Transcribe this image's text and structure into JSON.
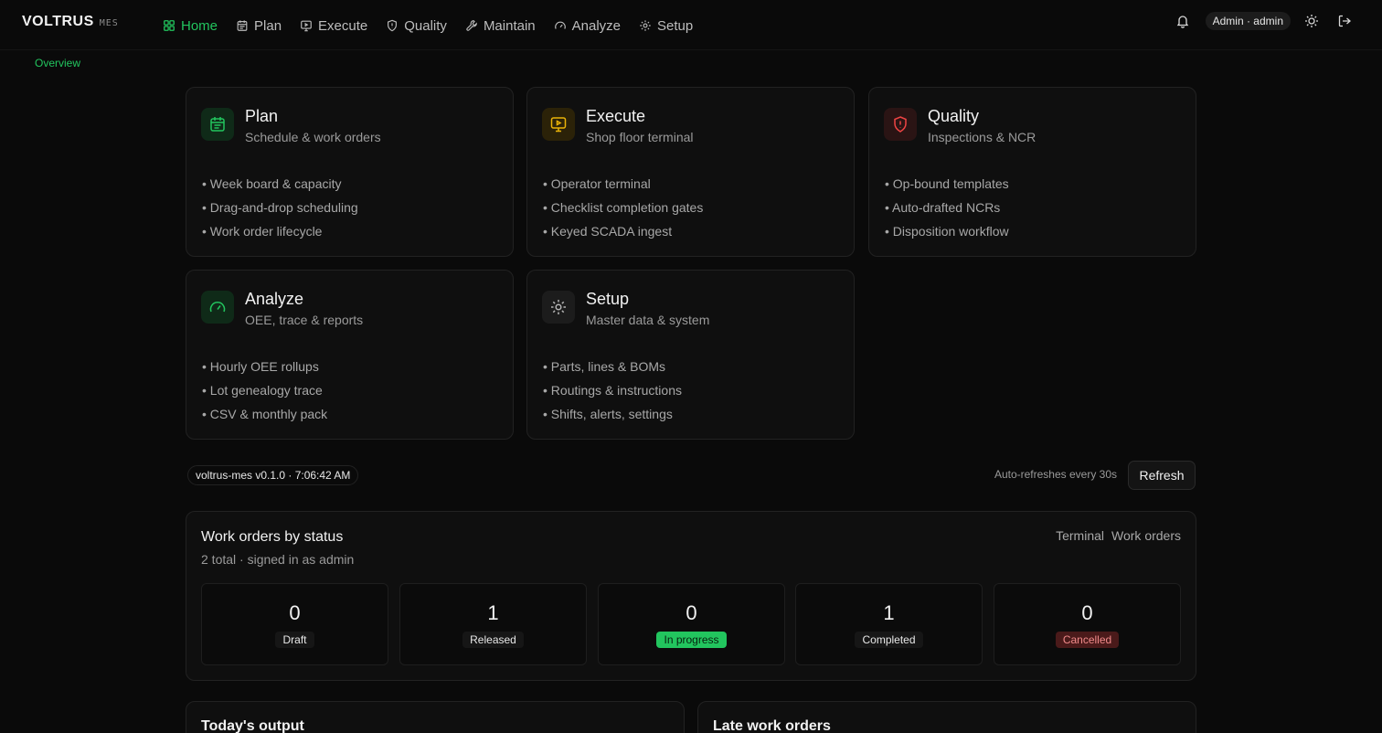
{
  "brand": {
    "name": "VOLTRUS",
    "suffix": "MES"
  },
  "nav": [
    {
      "label": "Home",
      "icon": "grid-icon",
      "active": true
    },
    {
      "label": "Plan",
      "icon": "calendar-icon"
    },
    {
      "label": "Execute",
      "icon": "monitor-icon"
    },
    {
      "label": "Quality",
      "icon": "shield-icon"
    },
    {
      "label": "Maintain",
      "icon": "wrench-icon"
    },
    {
      "label": "Analyze",
      "icon": "gauge-icon"
    },
    {
      "label": "Setup",
      "icon": "gear-icon"
    }
  ],
  "user": {
    "label": "Admin · admin"
  },
  "subnav": {
    "label": "Overview"
  },
  "modules": [
    {
      "title": "Plan",
      "subtitle": "Schedule & work orders",
      "icon": "calendar-icon",
      "color": "#22c55e",
      "items": [
        "Week board & capacity",
        "Drag-and-drop scheduling",
        "Work order lifecycle"
      ]
    },
    {
      "title": "Execute",
      "subtitle": "Shop floor terminal",
      "icon": "monitor-icon",
      "color": "#eab308",
      "items": [
        "Operator terminal",
        "Checklist completion gates",
        "Keyed SCADA ingest"
      ]
    },
    {
      "title": "Quality",
      "subtitle": "Inspections & NCR",
      "icon": "shield-icon",
      "color": "#ef4444",
      "items": [
        "Op-bound templates",
        "Auto-drafted NCRs",
        "Disposition workflow"
      ]
    },
    {
      "title": "Analyze",
      "subtitle": "OEE, trace & reports",
      "icon": "gauge-icon",
      "color": "#22c55e",
      "items": [
        "Hourly OEE rollups",
        "Lot genealogy trace",
        "CSV & monthly pack"
      ]
    },
    {
      "title": "Setup",
      "subtitle": "Master data & system",
      "icon": "gear-icon",
      "color": "#a3a3a3",
      "items": [
        "Parts, lines & BOMs",
        "Routings & instructions",
        "Shifts, alerts, settings"
      ]
    }
  ],
  "meta": {
    "version": "voltrus-mes v0.1.0 · 7:06:42 AM",
    "auto_refresh": "Auto-refreshes every 30s",
    "refresh_label": "Refresh"
  },
  "work_orders": {
    "title": "Work orders by status",
    "subtitle": "2 total · signed in as admin",
    "links": [
      "Terminal",
      "Work orders"
    ],
    "stats": [
      {
        "count": "0",
        "label": "Draft",
        "tone": "neutral"
      },
      {
        "count": "1",
        "label": "Released",
        "tone": "neutral"
      },
      {
        "count": "0",
        "label": "In progress",
        "tone": "green"
      },
      {
        "count": "1",
        "label": "Completed",
        "tone": "neutral"
      },
      {
        "count": "0",
        "label": "Cancelled",
        "tone": "red"
      }
    ]
  },
  "bottom": {
    "output_title": "Today's output",
    "late_title": "Late work orders"
  }
}
